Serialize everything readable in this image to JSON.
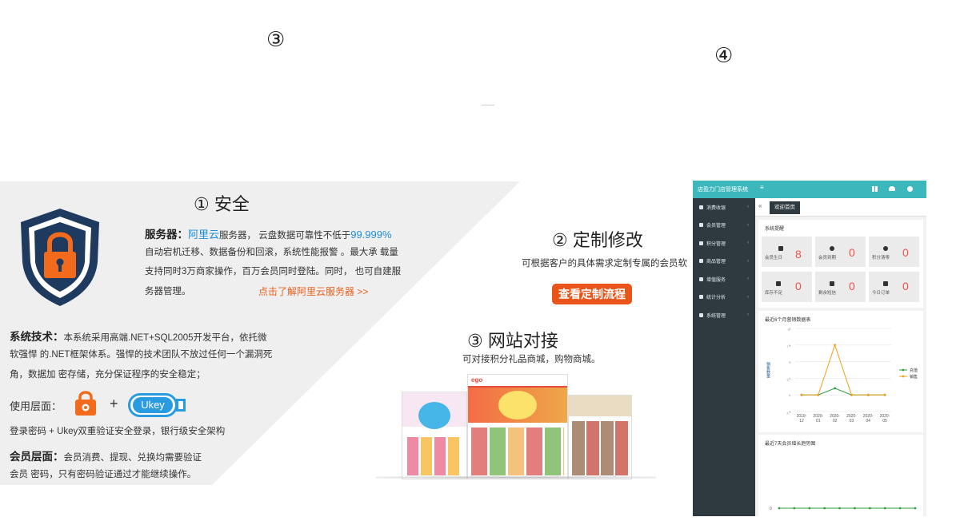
{
  "top_markers": {
    "left": "③",
    "right": "④"
  },
  "security": {
    "title": "① 安全",
    "server_label": "服务器：",
    "aliyun": "阿里云",
    "line1_mid": "服务器， 云盘数据可靠性不低于",
    "percent": "99.999%",
    "line2": "自动宕机迁移、数据备份和回滚，系统性能报警 。最大承 载量",
    "line3": "支持同时3万商家操作，百万会员同时登陆。同时， 也可自建服",
    "line4": "务器管理。",
    "link": "点击了解阿里云服务器 >>"
  },
  "tech": {
    "label": "系统技术：",
    "line1": "本系统采用高端.NET+SQL2005开发平台，依托微",
    "line2": "软强悍 的.NET框架体系。强悍的技术团队不放过任何一个漏洞死",
    "line3": "角，数据加 密存储，充分保证程序的安全稳定；"
  },
  "usage": {
    "label": "使用层面：",
    "plus": "+",
    "ukey": "Ukey",
    "desc": "登录密码 + Ukey双重验证安全登录，银行级安全架构"
  },
  "member": {
    "label": "会员层面：",
    "line1": "会员消费、提现、兑换均需要验证",
    "line2": "会员 密码，只有密码验证通过才能继续操作。"
  },
  "custom": {
    "title": "② 定制修改",
    "desc": "可根据客户的具体需求定制专属的会员软",
    "button": "查看定制流程"
  },
  "website": {
    "title": "③ 网站对接",
    "desc": "可对接积分礼品商城，购物商城。"
  },
  "dashboard": {
    "app_title": "店盈力门店管理系统",
    "menu_icon": "≡",
    "tab_nav": "«",
    "tab_active": "欢迎首页",
    "sidebar": [
      {
        "label": "消费收银",
        "icon": "cashier-icon"
      },
      {
        "label": "会员管理",
        "icon": "members-icon"
      },
      {
        "label": "积分管理",
        "icon": "points-icon"
      },
      {
        "label": "商品管理",
        "icon": "goods-icon"
      },
      {
        "label": "增值服务",
        "icon": "service-icon"
      },
      {
        "label": "统计分析",
        "icon": "stats-icon"
      },
      {
        "label": "系统管理",
        "icon": "settings-icon"
      }
    ],
    "reminder_title": "系统提醒",
    "cards": [
      {
        "label": "会员生日",
        "value": "8"
      },
      {
        "label": "会员到期",
        "value": "0"
      },
      {
        "label": "积分清零",
        "value": "0"
      },
      {
        "label": "库存不足",
        "value": "0"
      },
      {
        "label": "剩余短信",
        "value": "0"
      },
      {
        "label": "今日订单",
        "value": "0"
      }
    ],
    "chart1_title": "最近6个月营销数据表",
    "chart2_title": "最近7天会员增长趋势图",
    "chart2_zero": "0"
  },
  "chart_data": [
    {
      "type": "line",
      "title": "最近6个月营销数据表",
      "ylabel": "销售数量",
      "categories": [
        "2019-12",
        "2020-01",
        "2020-02",
        "2020-03",
        "2020-04",
        "2020-05"
      ],
      "ylim": [
        -2.5,
        10
      ],
      "yticks": [
        "10",
        "7.5",
        "5",
        "2.5",
        "0",
        "-2.5"
      ],
      "series": [
        {
          "name": "充值",
          "color": "#2e9e3e",
          "values": [
            0,
            0,
            1,
            0,
            0,
            0
          ]
        },
        {
          "name": "销售",
          "color": "#f0a020",
          "values": [
            0,
            0,
            7.5,
            0,
            0,
            0
          ]
        }
      ],
      "legend": "right"
    },
    {
      "type": "line",
      "title": "最近7天会员增长趋势图",
      "series": [
        {
          "values": [
            0,
            0,
            0,
            0,
            0,
            0,
            0,
            0,
            0,
            0
          ],
          "color": "#2e9e3e"
        }
      ]
    }
  ]
}
